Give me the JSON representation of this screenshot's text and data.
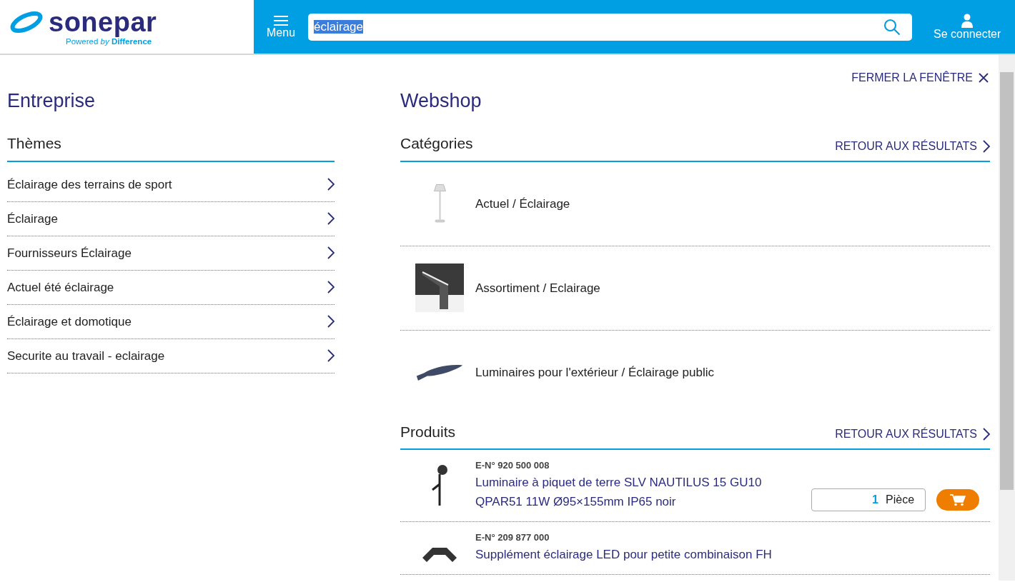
{
  "header": {
    "logo": {
      "wordmark": "sonepar",
      "tagline_start": "Powered ",
      "tagline_by": "by",
      "tagline_end": " Difference"
    },
    "menu_label": "Menu",
    "search": {
      "value": "éclairage"
    },
    "login_label": "Se connecter"
  },
  "close_label": "FERMER LA FENÊTRE",
  "entreprise": {
    "title": "Entreprise",
    "section": "Thèmes",
    "items": [
      {
        "label": "Éclairage des terrains de sport"
      },
      {
        "label": "Éclairage"
      },
      {
        "label": "Fournisseurs Éclairage"
      },
      {
        "label": "Actuel été éclairage"
      },
      {
        "label": "Éclairage et domotique"
      },
      {
        "label": "Securite au travail - eclairage"
      }
    ]
  },
  "webshop": {
    "title": "Webshop",
    "categories": {
      "title": "Catégories",
      "back_label": "RETOUR AUX RÉSULTATS",
      "items": [
        {
          "label": "Actuel / Éclairage"
        },
        {
          "label": "Assortiment / Eclairage"
        },
        {
          "label": "Luminaires pour l'extérieur / Éclairage public"
        }
      ]
    },
    "products": {
      "title": "Produits",
      "back_label": "RETOUR AUX RÉSULTATS",
      "items": [
        {
          "number": "E-N° 920 500 008",
          "name": "Luminaire à piquet de terre SLV NAUTILUS 15 GU10 QPAR51 11W Ø95×155mm IP65 noir",
          "quantity": "1",
          "unit": "Pièce"
        },
        {
          "number": "E-N° 209 877 000",
          "name": "Supplément éclairage LED pour petite combinaison FH"
        }
      ]
    }
  }
}
